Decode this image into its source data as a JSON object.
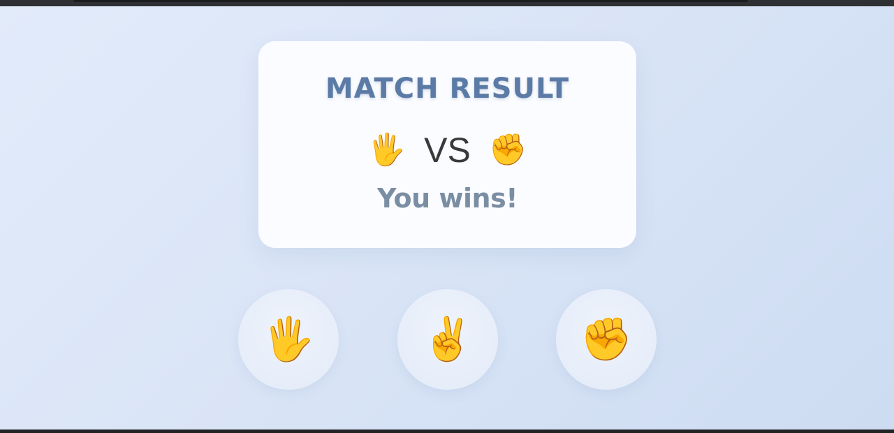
{
  "result_card": {
    "title": "MATCH RESULT",
    "player_choice": "🖐️",
    "vs_label": "VS",
    "computer_choice": "✊",
    "result_text": "You wins!"
  },
  "choices": {
    "paper": "🖐️",
    "scissors": "✌️",
    "rock": "✊"
  }
}
